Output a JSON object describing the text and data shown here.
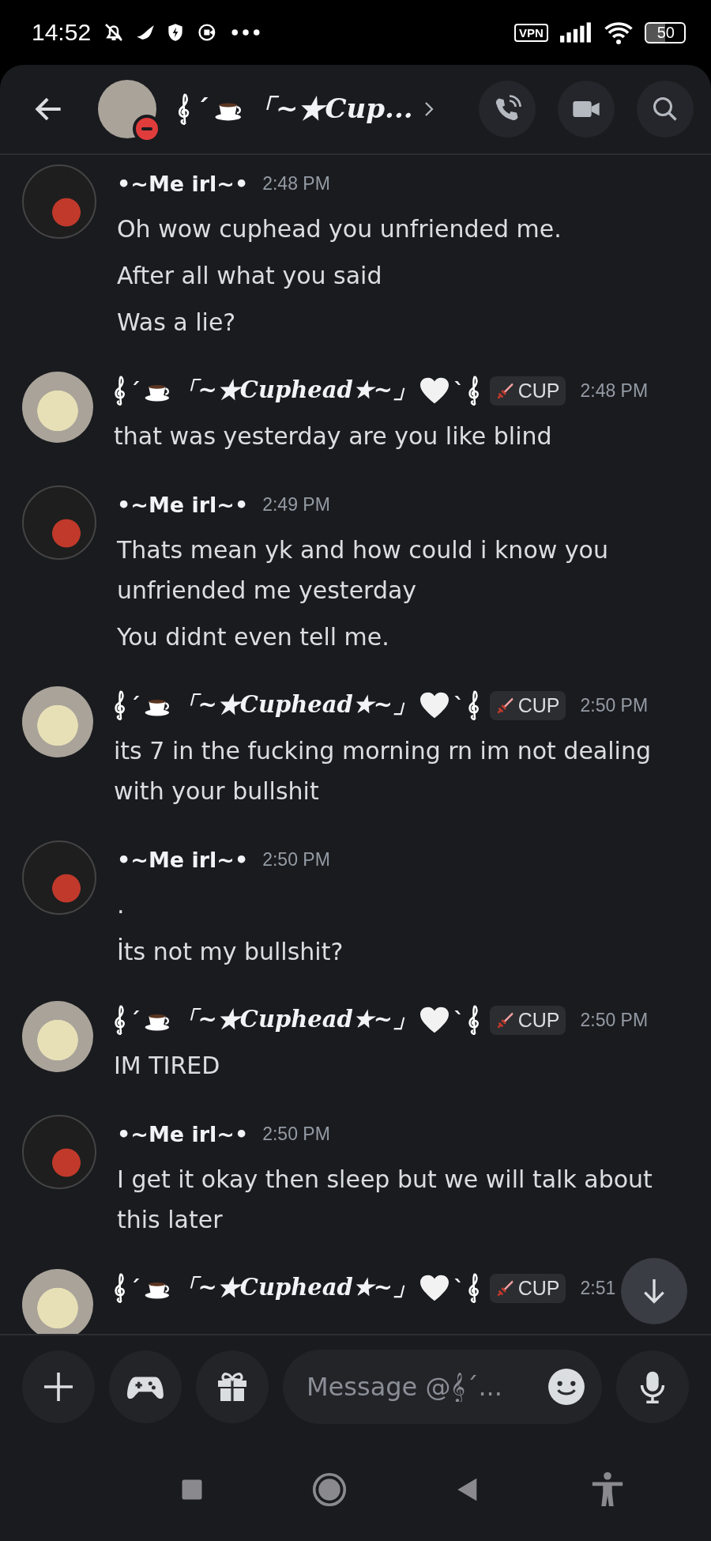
{
  "status_bar": {
    "time": "14:52",
    "vpn": "VPN",
    "battery": "50"
  },
  "header": {
    "title": [
      {
        "kind": "clef"
      },
      {
        "kind": "text",
        "text": "´"
      },
      {
        "kind": "coffee"
      },
      {
        "kind": "fancy_text",
        "text": "「~★Cup..."
      }
    ]
  },
  "messages": [
    {
      "kind": "dark_avatar",
      "name": [
        {
          "kind": "text",
          "text": "•~Me irl~•"
        }
      ],
      "time": "2:48 PM",
      "lines": [
        "Oh wow cuphead you unfriended me.",
        "After all what you said",
        "Was a lie?"
      ]
    },
    {
      "kind": "light_avatar",
      "name": [
        {
          "kind": "clef"
        },
        {
          "kind": "text",
          "text": "´"
        },
        {
          "kind": "coffee"
        },
        {
          "kind": "fancy_text",
          "text": "「~★Cuphead★~」"
        },
        {
          "kind": "heart"
        },
        {
          "kind": "text",
          "text": "`"
        },
        {
          "kind": "clef"
        }
      ],
      "tag": "CUP",
      "time": "2:48 PM",
      "lines": [
        "that was yesterday are you like blind"
      ]
    },
    {
      "kind": "dark_avatar",
      "name": [
        {
          "kind": "text",
          "text": "•~Me irl~•"
        }
      ],
      "time": "2:49 PM",
      "lines": [
        "Thats mean yk and how could i know you unfriended me yesterday",
        "You didnt even tell me."
      ]
    },
    {
      "kind": "light_avatar",
      "name": [
        {
          "kind": "clef"
        },
        {
          "kind": "text",
          "text": "´"
        },
        {
          "kind": "coffee"
        },
        {
          "kind": "fancy_text",
          "text": "「~★Cuphead★~」"
        },
        {
          "kind": "heart"
        },
        {
          "kind": "text",
          "text": "`"
        },
        {
          "kind": "clef"
        }
      ],
      "tag": "CUP",
      "time": "2:50 PM",
      "lines": [
        "its 7 in the fucking morning rn im not dealing with your bullshit"
      ]
    },
    {
      "kind": "dark_avatar",
      "name": [
        {
          "kind": "text",
          "text": "•~Me irl~•"
        }
      ],
      "time": "2:50 PM",
      "lines": [
        ".",
        "İts not my bullshit?"
      ]
    },
    {
      "kind": "light_avatar",
      "name": [
        {
          "kind": "clef"
        },
        {
          "kind": "text",
          "text": "´"
        },
        {
          "kind": "coffee"
        },
        {
          "kind": "fancy_text",
          "text": "「~★Cuphead★~」"
        },
        {
          "kind": "heart"
        },
        {
          "kind": "text",
          "text": "`"
        },
        {
          "kind": "clef"
        }
      ],
      "tag": "CUP",
      "time": "2:50 PM",
      "lines": [
        "IM TIRED"
      ]
    },
    {
      "kind": "dark_avatar",
      "name": [
        {
          "kind": "text",
          "text": "•~Me irl~•"
        }
      ],
      "time": "2:50 PM",
      "lines": [
        "I get it okay then sleep but we will talk about this later"
      ]
    },
    {
      "kind": "light_avatar",
      "name": [
        {
          "kind": "clef"
        },
        {
          "kind": "text",
          "text": "´"
        },
        {
          "kind": "coffee"
        },
        {
          "kind": "fancy_text",
          "text": "「~★Cuphead★~」"
        },
        {
          "kind": "heart"
        },
        {
          "kind": "text",
          "text": "`"
        },
        {
          "kind": "clef"
        }
      ],
      "tag": "CUP",
      "time": "2:51"
    }
  ],
  "composer": {
    "placeholder": "Message @𝄞´..."
  }
}
